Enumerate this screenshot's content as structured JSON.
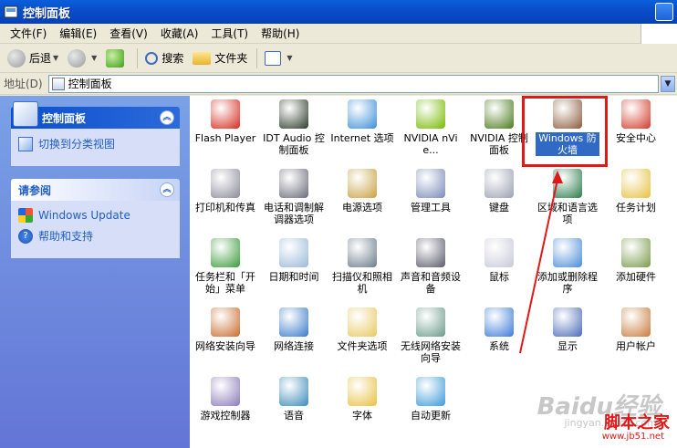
{
  "window": {
    "title": "控制面板"
  },
  "menu": [
    "文件(F)",
    "编辑(E)",
    "查看(V)",
    "收藏(A)",
    "工具(T)",
    "帮助(H)"
  ],
  "toolbar": {
    "back_label": "后退",
    "search_label": "搜索",
    "folders_label": "文件夹"
  },
  "address": {
    "label": "地址(D)",
    "value": "控制面板"
  },
  "leftpanel": {
    "box1": {
      "title": "控制面板",
      "links": [
        "切换到分类视图"
      ]
    },
    "box2": {
      "title": "请参阅",
      "links": [
        "Windows Update",
        "帮助和支持"
      ]
    }
  },
  "items": [
    {
      "label": "Flash Player",
      "color": "#d62a1e"
    },
    {
      "label": "IDT Audio 控制面板",
      "color": "#2b3a2a"
    },
    {
      "label": "Internet 选项",
      "color": "#3a8ed8"
    },
    {
      "label": "NVIDIA nVie...",
      "color": "#76b900"
    },
    {
      "label": "NVIDIA 控制面板",
      "color": "#4a7a1a"
    },
    {
      "label": "Windows 防火墙",
      "color": "#8a5a3a",
      "selected": true
    },
    {
      "label": "安全中心",
      "color": "#d33a2a"
    },
    {
      "label": "打印机和传真",
      "color": "#8a8a9a"
    },
    {
      "label": "电话和调制解调器选项",
      "color": "#6a6a7a"
    },
    {
      "label": "电源选项",
      "color": "#c8a040"
    },
    {
      "label": "管理工具",
      "color": "#7a8ab8"
    },
    {
      "label": "键盘",
      "color": "#9aa0b0"
    },
    {
      "label": "区域和语言选项",
      "color": "#2a7a4a"
    },
    {
      "label": "任务计划",
      "color": "#e8c040"
    },
    {
      "label": "任务栏和「开始」菜单",
      "color": "#3a9a3a"
    },
    {
      "label": "日期和时间",
      "color": "#9ab8d8"
    },
    {
      "label": "扫描仪和照相机",
      "color": "#6a7a8a"
    },
    {
      "label": "声音和音频设备",
      "color": "#5a5a6a"
    },
    {
      "label": "鼠标",
      "color": "#c8c8d8"
    },
    {
      "label": "添加或删除程序",
      "color": "#4a8ad8"
    },
    {
      "label": "添加硬件",
      "color": "#7a9a4a"
    },
    {
      "label": "网络安装向导",
      "color": "#c86a2a"
    },
    {
      "label": "网络连接",
      "color": "#3a7ac8"
    },
    {
      "label": "文件夹选项",
      "color": "#e8c860"
    },
    {
      "label": "无线网络安装向导",
      "color": "#6a9a8a"
    },
    {
      "label": "系统",
      "color": "#3a7ad8"
    },
    {
      "label": "显示",
      "color": "#4a6ab8"
    },
    {
      "label": "用户帐户",
      "color": "#c87a3a"
    },
    {
      "label": "游戏控制器",
      "color": "#8a7ab8"
    },
    {
      "label": "语音",
      "color": "#3a8ab8"
    },
    {
      "label": "字体",
      "color": "#e8c040"
    },
    {
      "label": "自动更新",
      "color": "#3a9ad8"
    }
  ],
  "watermark": {
    "brand": "Baidu经验",
    "url": "jingyan.baidu.com",
    "site": "脚本之家",
    "site_url": "www.jb51.net"
  }
}
